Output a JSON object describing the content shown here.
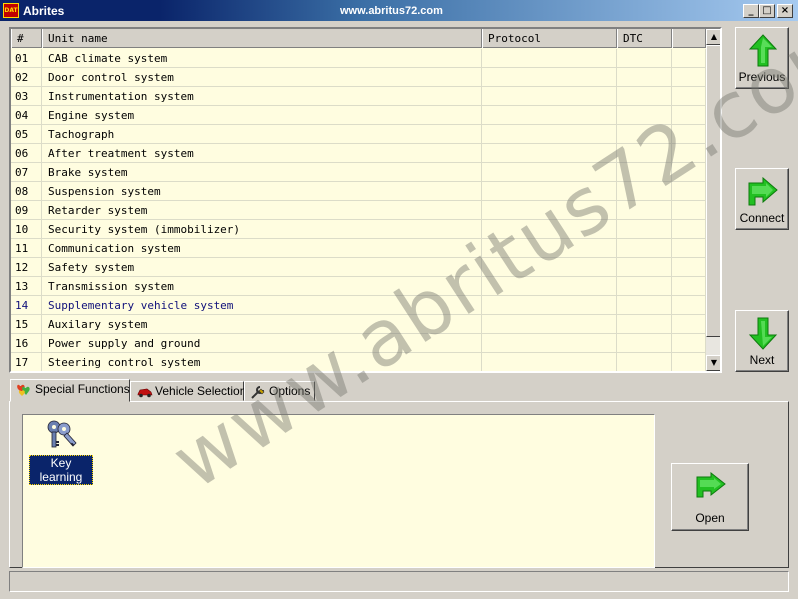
{
  "window": {
    "title": "Abrites",
    "url_caption": "www.abritus72.com",
    "icon_text": "DAT",
    "minimize": "_",
    "maximize": "□",
    "close": "×"
  },
  "table": {
    "columns": [
      "#",
      "Unit name",
      "Protocol",
      "DTC",
      ""
    ],
    "rows": [
      {
        "num": "01",
        "name": "CAB climate system",
        "protocol": "",
        "dtc": ""
      },
      {
        "num": "02",
        "name": "Door control system",
        "protocol": "",
        "dtc": ""
      },
      {
        "num": "03",
        "name": "Instrumentation system",
        "protocol": "",
        "dtc": ""
      },
      {
        "num": "04",
        "name": "Engine system",
        "protocol": "",
        "dtc": ""
      },
      {
        "num": "05",
        "name": "Tachograph",
        "protocol": "",
        "dtc": ""
      },
      {
        "num": "06",
        "name": "After treatment system",
        "protocol": "",
        "dtc": ""
      },
      {
        "num": "07",
        "name": "Brake system",
        "protocol": "",
        "dtc": ""
      },
      {
        "num": "08",
        "name": "Suspension system",
        "protocol": "",
        "dtc": ""
      },
      {
        "num": "09",
        "name": "Retarder system",
        "protocol": "",
        "dtc": ""
      },
      {
        "num": "10",
        "name": "Security system (immobilizer)",
        "protocol": "",
        "dtc": ""
      },
      {
        "num": "11",
        "name": "Communication system",
        "protocol": "",
        "dtc": ""
      },
      {
        "num": "12",
        "name": "Safety system",
        "protocol": "",
        "dtc": ""
      },
      {
        "num": "13",
        "name": "Transmission system",
        "protocol": "",
        "dtc": ""
      },
      {
        "num": "14",
        "name": "Supplementary vehicle system",
        "protocol": "",
        "dtc": ""
      },
      {
        "num": "15",
        "name": "Auxilary system",
        "protocol": "",
        "dtc": ""
      },
      {
        "num": "16",
        "name": "Power supply and ground",
        "protocol": "",
        "dtc": ""
      },
      {
        "num": "17",
        "name": "Steering control system",
        "protocol": "",
        "dtc": ""
      }
    ],
    "selected_row": "14",
    "scroll_up": "▲",
    "scroll_down": "▼"
  },
  "nav": {
    "previous": "Previous",
    "connect": "Connect",
    "next": "Next"
  },
  "tabs": [
    {
      "label": "Special Functions",
      "icon": "hearts-icon",
      "active": true
    },
    {
      "label": "Vehicle Selection",
      "icon": "car-icon",
      "active": false
    },
    {
      "label": "Options",
      "icon": "wrench-icon",
      "active": false
    }
  ],
  "functions": {
    "items": [
      {
        "label": "Key learning",
        "icon": "keys-icon"
      }
    ],
    "open": "Open"
  },
  "status": {
    "text": ""
  },
  "watermark": "www.abritus72.com",
  "colors": {
    "list_bg": "#fffde0",
    "title_bar": "#0a246a",
    "arrow_green": "#22c022",
    "selected_text": "#10107a"
  }
}
